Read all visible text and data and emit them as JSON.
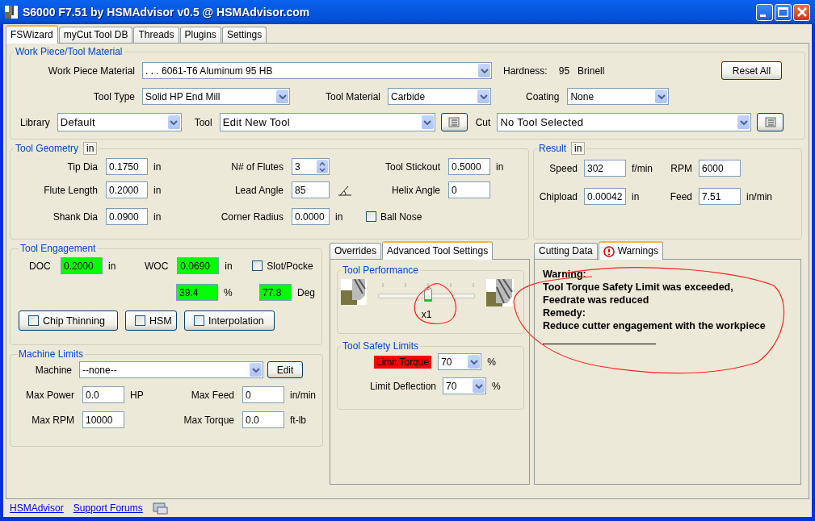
{
  "window": {
    "title": "S6000 F7.51 by HSMAdvisor v0.5 @ HSMAdvisor.com"
  },
  "tabs": [
    {
      "label": "FSWizard",
      "selected": true
    },
    {
      "label": "myCut Tool DB",
      "selected": false
    },
    {
      "label": "Threads",
      "selected": false
    },
    {
      "label": "Plugins",
      "selected": false
    },
    {
      "label": "Settings",
      "selected": false
    }
  ],
  "work_piece": {
    "title": "Work Piece/Tool Material",
    "material": {
      "label": "Work Piece Material",
      "value": ". . . 6061-T6 Aluminum 95 HB"
    },
    "hardness": {
      "label": "Hardness:",
      "value": "95",
      "unit": "Brinell"
    },
    "reset_button": "Reset All",
    "tool_type": {
      "label": "Tool Type",
      "value": "Solid HP End Mill"
    },
    "tool_material": {
      "label": "Tool Material",
      "value": "Carbide"
    },
    "coating": {
      "label": "Coating",
      "value": "None"
    },
    "library": {
      "label": "Library",
      "value": "Default"
    },
    "tool": {
      "label": "Tool",
      "value": "Edit New Tool"
    },
    "cut": {
      "label": "Cut",
      "value": "No Tool Selected"
    }
  },
  "tool_geometry": {
    "title": "Tool Geometry",
    "unit_button": "in",
    "rows": [
      [
        {
          "kind": "field",
          "label": "Tip Dia",
          "value": "0.1750",
          "unit": "in"
        },
        {
          "kind": "spinner",
          "label": "N# of Flutes",
          "value": "3"
        },
        {
          "kind": "field",
          "label": "Tool Stickout",
          "value": "0.5000",
          "unit": "in"
        }
      ],
      [
        {
          "kind": "field",
          "label": "Flute Length",
          "value": "0.2000",
          "unit": "in"
        },
        {
          "kind": "angle",
          "label": "Lead Angle",
          "value": "85"
        },
        {
          "kind": "field",
          "label": "Helix Angle",
          "value": "0"
        }
      ],
      [
        {
          "kind": "field",
          "label": "Shank Dia",
          "value": "0.0900",
          "unit": "in"
        },
        {
          "kind": "field",
          "label": "Corner Radius",
          "value": "0.0000",
          "unit": "in"
        },
        {
          "kind": "checkbox",
          "label": "Ball Nose",
          "checked": false
        }
      ]
    ]
  },
  "result": {
    "title": "Result",
    "unit_button": "in",
    "rows": [
      [
        {
          "label": "Speed",
          "value": "302",
          "unit": "f/min"
        },
        {
          "label": "RPM",
          "value": "6000"
        }
      ],
      [
        {
          "label": "Chipload",
          "value": "0.00042",
          "unit": "in"
        },
        {
          "label": "Feed",
          "value": "7.51",
          "unit": "in/min"
        }
      ]
    ]
  },
  "tool_engagement": {
    "title": "Tool Engagement",
    "doc": {
      "label": "DOC",
      "value": "0.2000",
      "unit": "in",
      "highlighted": true
    },
    "woc": {
      "label": "WOC",
      "value": "0.0690",
      "unit": "in",
      "highlighted": true
    },
    "slot_pocket": {
      "label": "Slot/Pocke",
      "checked": false
    },
    "percent": {
      "value": "39.4",
      "unit": "%",
      "highlighted": true
    },
    "angle": {
      "value": "77.8",
      "unit": "Deg",
      "highlighted": true
    },
    "toggles": [
      {
        "label": "Chip Thinning",
        "checked": false
      },
      {
        "label": "HSM",
        "checked": false
      },
      {
        "label": "Interpolation",
        "checked": false
      }
    ]
  },
  "machine_limits": {
    "title": "Machine Limits",
    "machine": {
      "label": "Machine",
      "value": "--none--"
    },
    "edit_button": "Edit",
    "rows": [
      [
        {
          "label": "Max Power",
          "value": "0.0",
          "unit": "HP"
        },
        {
          "label": "Max Feed",
          "value": "0",
          "unit": "in/min"
        }
      ],
      [
        {
          "label": "Max RPM",
          "value": "10000"
        },
        {
          "label": "Max Torque",
          "value": "0.0",
          "unit": "ft-lb"
        }
      ]
    ]
  },
  "settings_tabs": [
    {
      "label": "Overrides",
      "selected": false
    },
    {
      "label": "Advanced Tool Settings",
      "selected": true
    }
  ],
  "tool_performance": {
    "title": "Tool Performance",
    "level": 0.52,
    "reading": "x1"
  },
  "tool_safety_limits": {
    "title": "Tool Safety Limits",
    "rows": [
      {
        "label": "Limit Torque",
        "value": "70",
        "unit": "%",
        "alert": true
      },
      {
        "label": "Limit Deflection",
        "value": "70",
        "unit": "%",
        "alert": false
      }
    ]
  },
  "output_tabs": [
    {
      "label": "Cutting Data",
      "selected": false,
      "warning": false
    },
    {
      "label": "Warnings",
      "selected": true,
      "warning": true
    }
  ],
  "warnings": {
    "lines": [
      "Warning:",
      "Tool Torque Safety Limit was exceeded,",
      "Feedrate was reduced",
      "Remedy:",
      "Reduce cutter engagement with the workpiece"
    ]
  },
  "footer": {
    "links": [
      "HSMAdvisor",
      "Support Forums"
    ]
  }
}
